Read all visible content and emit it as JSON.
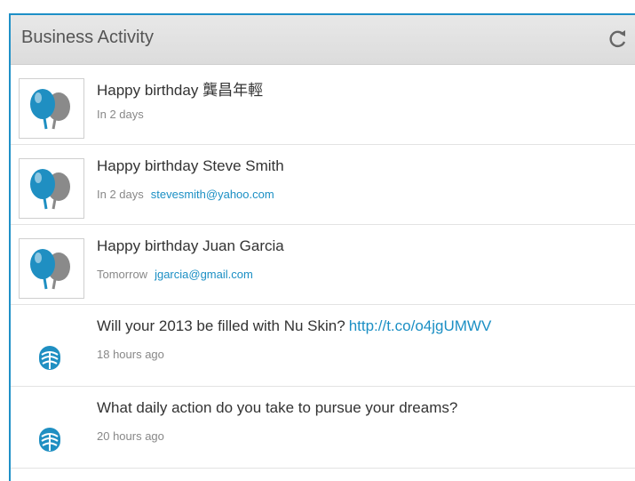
{
  "header": {
    "title": "Business Activity",
    "refresh_icon": "refresh-icon"
  },
  "colors": {
    "accent": "#1e90c7",
    "link": "#1b8fc4",
    "balloon_blue": "#1f8fc2",
    "balloon_gray": "#8a8a8a"
  },
  "items": [
    {
      "title": "Happy birthday 龔昌年輕",
      "meta": "In 2 days",
      "link": "",
      "icon": "balloons-icon"
    },
    {
      "title": "Happy birthday Steve Smith",
      "meta": "In 2 days",
      "link": "stevesmith@yahoo.com",
      "icon": "balloons-icon"
    },
    {
      "title": "Happy birthday Juan Garcia",
      "meta": "Tomorrow",
      "link": "jgarcia@gmail.com",
      "icon": "balloons-icon"
    },
    {
      "title": "Will your 2013 be filled with Nu Skin?",
      "title_link": "http://t.co/o4jgUMWV",
      "meta": "18 hours ago",
      "icon": "nu-skin-logo-icon"
    },
    {
      "title": "What daily action do you take to pursue your dreams?",
      "meta": "20 hours ago",
      "icon": "nu-skin-logo-icon"
    }
  ]
}
